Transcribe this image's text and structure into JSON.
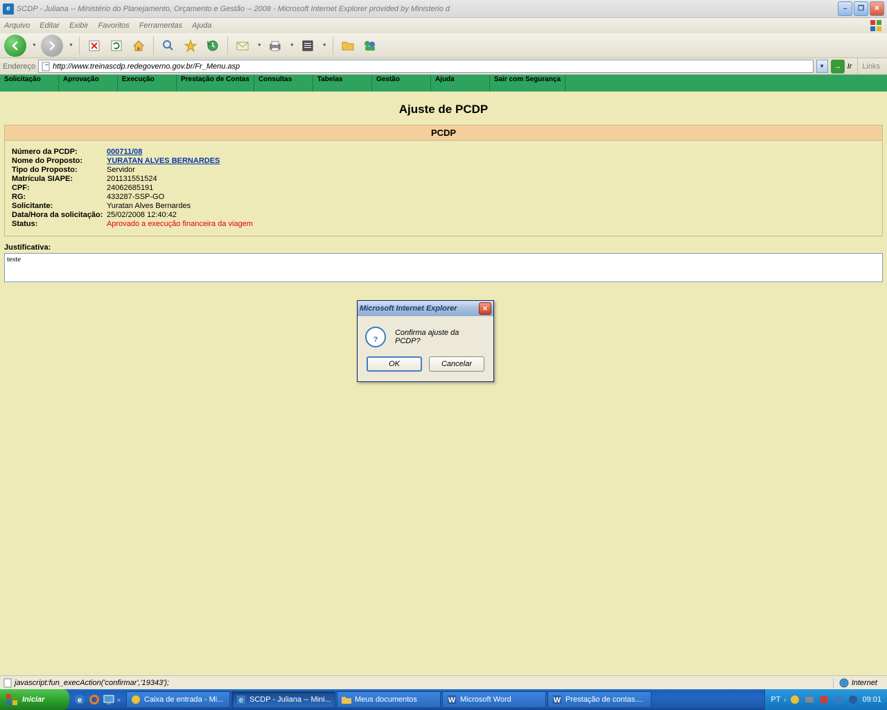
{
  "browser": {
    "title": "SCDP - Juliana -- Ministério do Planejamento, Orçamento e Gestão -- 2008 - Microsoft Internet Explorer provided by Ministerio d",
    "menus": [
      "Arquivo",
      "Editar",
      "Exibir",
      "Favoritos",
      "Ferramentas",
      "Ajuda"
    ],
    "address_label": "Endereço",
    "url": "http://www.treinascdp.redegoverno.gov.br/Fr_Menu.asp",
    "go_label": "Ir",
    "links_label": "Links"
  },
  "appmenu": [
    "Solicitação",
    "Aprovação",
    "Execução",
    "Prestação de Contas",
    "Consultas",
    "Tabelas",
    "Gestão",
    "Ajuda",
    "Sair com Segurança"
  ],
  "page": {
    "title": "Ajuste de PCDP",
    "panel_header": "PCDP",
    "fields": {
      "numero_label": "Número da PCDP:",
      "numero_value": "000711/08",
      "nome_label": "Nome do Proposto:",
      "nome_value": "YURATAN ALVES BERNARDES",
      "tipo_label": "Tipo do Proposto:",
      "tipo_value": "Servidor",
      "matricula_label": "Matrícula SIAPE:",
      "matricula_value": "201131551524",
      "cpf_label": "CPF:",
      "cpf_value": "24062685191",
      "rg_label": "RG:",
      "rg_value": "433287-SSP-GO",
      "solicitante_label": "Solicitante:",
      "solicitante_value": "Yuratan Alves Bernardes",
      "datahora_label": "Data/Hora da solicitação:",
      "datahora_value": "25/02/2008 12:40:42",
      "status_label": "Status:",
      "status_value": "Aprovado a execução financeira da viagem"
    },
    "justificativa_label": "Justificativa:",
    "justificativa_value": "teste"
  },
  "dialog": {
    "title": "Microsoft Internet Explorer",
    "message": "Confirma ajuste da PCDP?",
    "ok": "OK",
    "cancel": "Cancelar"
  },
  "statusbar": {
    "text": "javascript:fun_execAction('confirmar','19343');",
    "zone": "Internet"
  },
  "taskbar": {
    "start": "Iniciar",
    "tasks": [
      "Caixa de entrada - Mi...",
      "SCDP - Juliana -- Mini...",
      "Meus documentos",
      "Microsoft Word",
      "Prestação de contas...."
    ],
    "lang": "PT",
    "clock": "09:01"
  }
}
